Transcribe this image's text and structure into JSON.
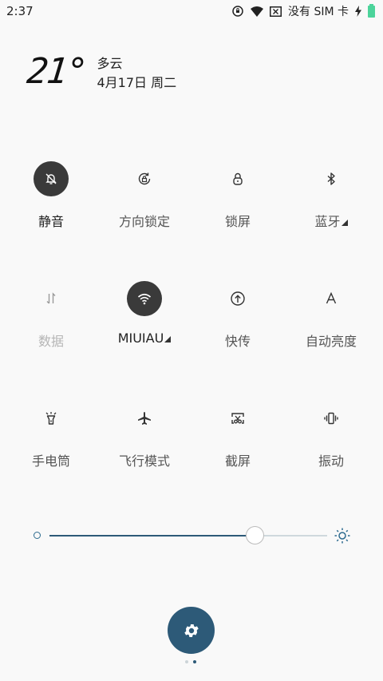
{
  "status": {
    "time": "2:37",
    "no_sim": "没有 SIM 卡"
  },
  "weather": {
    "temperature": "21°",
    "condition": "多云",
    "date": "4月17日 周二"
  },
  "toggles": [
    {
      "label": "静音",
      "icon": "bell-off-icon",
      "active": true
    },
    {
      "label": "方向锁定",
      "icon": "rotation-lock-icon",
      "active": false
    },
    {
      "label": "锁屏",
      "icon": "lock-icon",
      "active": false
    },
    {
      "label": "蓝牙",
      "icon": "bluetooth-icon",
      "active": false
    },
    {
      "label": "数据",
      "icon": "data-arrows-icon",
      "active": false
    },
    {
      "label": "MIUIAU",
      "icon": "wifi-icon",
      "active": true
    },
    {
      "label": "快传",
      "icon": "upload-circle-icon",
      "active": false
    },
    {
      "label": "自动亮度",
      "icon": "auto-brightness-icon",
      "active": false
    },
    {
      "label": "手电筒",
      "icon": "flashlight-icon",
      "active": false
    },
    {
      "label": "飞行模式",
      "icon": "airplane-icon",
      "active": false
    },
    {
      "label": "截屏",
      "icon": "screenshot-icon",
      "active": false
    },
    {
      "label": "振动",
      "icon": "vibrate-icon",
      "active": false
    }
  ],
  "brightness": {
    "level": 0.74
  },
  "pager": {
    "pages": 2,
    "current": 2
  },
  "colors": {
    "accent": "#2d5a78",
    "active_toggle": "#3a3a3a"
  }
}
